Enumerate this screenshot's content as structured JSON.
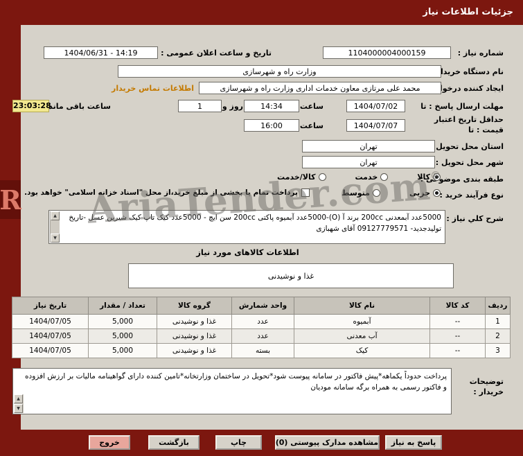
{
  "colors": {
    "bar": "#7c170f",
    "page_bg": "#d6d2c9",
    "countdown_bg": "#f2e88f",
    "contact_link": "#c47a00",
    "exit_button_bg": "#e8a69c",
    "table_header_bg": "#c7c3ba"
  },
  "header": {
    "title": "جزئیات اطلاعات نیاز"
  },
  "watermark": {
    "text": "AriaTender.com",
    "reg": "®",
    "logo_letter": "R"
  },
  "form": {
    "need_number": {
      "label": "شماره نیاز :",
      "value": "1104000004000159"
    },
    "announce": {
      "label": "تاریخ و ساعت اعلان عمومی :",
      "value": "1404/06/31 - 14:19"
    },
    "buyer_org": {
      "label": "نام دستگاه خریدار :",
      "value": "وزارت راه و شهرسازی"
    },
    "creator": {
      "label": "ایجاد کننده درخواست :",
      "value": "محمد علی مرتازی معاون خدمات اداری وزارت راه و شهرسازی",
      "contact_link": "اطلاعات تماس خریدار"
    },
    "deadline": {
      "label": "مهلت ارسال پاسخ : تا",
      "date": "1404/07/02",
      "hour_word": "ساعت",
      "time": "14:34",
      "days": "1",
      "days_word": "روز و",
      "countdown": "23:03:28",
      "remaining_word": "ساعت باقی مانده"
    },
    "validity": {
      "label": "حداقل تاریخ اعتبار قیمت : تا",
      "date": "1404/07/07",
      "hour_word": "ساعت",
      "time": "16:00"
    },
    "province": {
      "label": "استان محل تحویل :",
      "value": "تهران"
    },
    "city": {
      "label": "شهر محل تحویل :",
      "value": "تهران"
    },
    "category": {
      "label": "طبقه بندی موضوعی :",
      "options": [
        {
          "label": "کالا",
          "selected": true
        },
        {
          "label": "خدمت",
          "selected": false
        },
        {
          "label": "کالا/خدمت",
          "selected": false
        }
      ]
    },
    "process": {
      "label": "نوع فرآیند خرید :",
      "options": [
        {
          "label": "جزیی",
          "selected": true
        },
        {
          "label": "متوسط",
          "selected": false
        }
      ],
      "treasury_note": "پرداخت تمام یا بخشی از مبلغ خرید،از محل \"اسناد خزانه اسلامی\" خواهد بود."
    },
    "description": {
      "label": "شرح کلي نياز :",
      "value": "5000عدد آبمعدنی 200cc برند آ (O)-5000عدد آبمیوه پاکتی 200cc سن ایچ - 5000عدد کیک تاپ کیک شیرین عسل -تاریخ تولیدجدید- 09127779571 آقای شهبازی"
    }
  },
  "items_section": {
    "title": "اطلاعات کالاهای مورد نیاز",
    "group_value": "غذا و نوشیدنی",
    "table": {
      "headers": [
        "ردیف",
        "کد کالا",
        "نام کالا",
        "واحد شمارش",
        "گروه کالا",
        "تعداد / مقدار",
        "تاریخ نیاز"
      ],
      "rows": [
        [
          "1",
          "--",
          "آبمیوه",
          "عدد",
          "غذا و نوشیدنی",
          "5,000",
          "1404/07/05"
        ],
        [
          "2",
          "--",
          "آب معدنی",
          "عدد",
          "غذا و نوشیدنی",
          "5,000",
          "1404/07/05"
        ],
        [
          "3",
          "--",
          "کیک",
          "بسته",
          "غذا و نوشیدنی",
          "5,000",
          "1404/07/05"
        ]
      ]
    }
  },
  "buyer_notes": {
    "label": "توضیحات خریدار :",
    "value": "پرداخت حدوداً یکماهه*پیش فاکتور در سامانه پیوست شود*تحویل در ساختمان وزارتخانه*تامین کننده دارای گواهینامه مالیات بر ارزش افزوده و فاکتور رسمی به همراه برگه سامانه مودیان"
  },
  "footer": {
    "buttons": [
      {
        "label": "خروج"
      },
      {
        "label": "بازگشت"
      },
      {
        "label": "چاپ"
      },
      {
        "label": "مشاهده مدارک پیوستی (0)"
      },
      {
        "label": "پاسخ به نیاز"
      }
    ]
  }
}
